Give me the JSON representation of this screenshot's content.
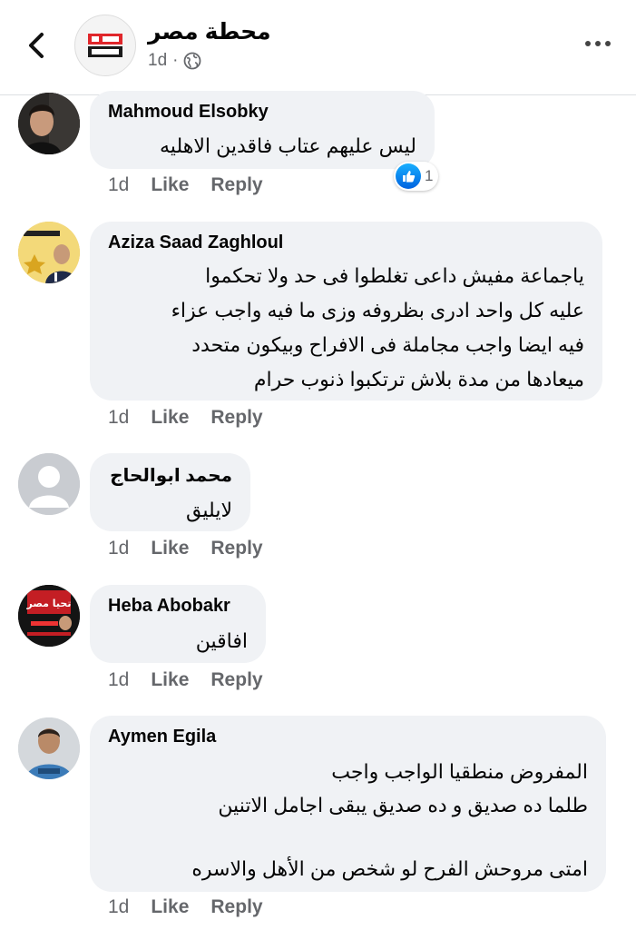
{
  "header": {
    "page_name": "محطة مصر",
    "time": "1d",
    "separator": "·",
    "logo_text": "محطة مصر"
  },
  "comments": [
    {
      "author": "Mahmoud Elsobky",
      "lines": [
        "ليس عليهم عتاب فاقدين الاهليه"
      ],
      "time": "1d",
      "like": "Like",
      "reply": "Reply",
      "reaction_count": "1"
    },
    {
      "author": "Aziza Saad Zaghloul",
      "lines": [
        "ياجماعة مفيش داعى تغلطوا فى حد ولا تحكموا",
        "عليه كل واحد ادرى بظروفه وزى ما فيه واجب عزاء",
        "فيه ايضا واجب مجاملة فى الافراح وبيكون متحدد",
        "ميعادها من مدة بلاش ترتكبوا ذنوب حرام"
      ],
      "time": "1d",
      "like": "Like",
      "reply": "Reply"
    },
    {
      "author": "محمد ابوالحاج",
      "lines": [
        "لايليق"
      ],
      "time": "1d",
      "like": "Like",
      "reply": "Reply"
    },
    {
      "author": "Heba Abobakr",
      "lines": [
        "افاقين"
      ],
      "time": "1d",
      "like": "Like",
      "reply": "Reply",
      "avatar_text": "تحيا مصر"
    },
    {
      "author": "Aymen Egila",
      "lines": [
        "المفروض منطقيا الواجب واجب",
        "طلما ده صديق و ده صديق يبقى اجامل الاتنين",
        "",
        "امتى مروحش  الفرح لو شخص من الأهل والاسره"
      ],
      "time": "1d",
      "like": "Like",
      "reply": "Reply"
    }
  ]
}
